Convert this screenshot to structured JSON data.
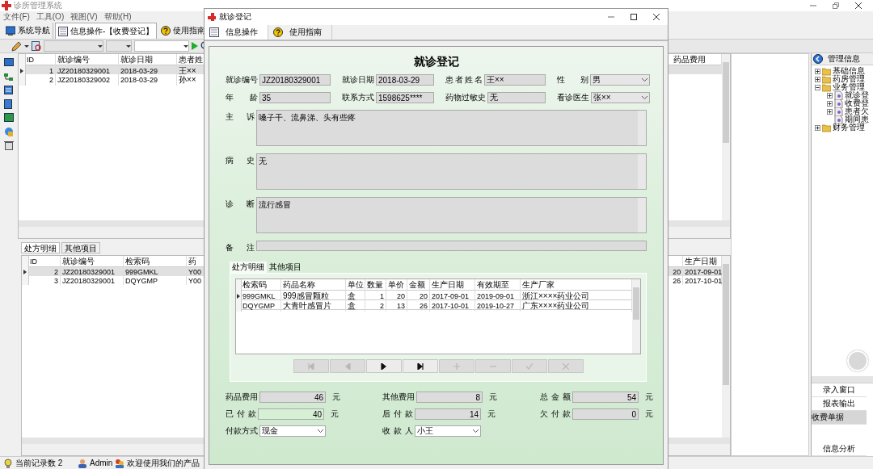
{
  "app": {
    "title": "诊所管理系统",
    "menu": [
      "文件(F)",
      "工具(O)",
      "视图(V)",
      "帮助(H)"
    ],
    "nav_tabs": [
      {
        "label": "系统导航",
        "selected": false,
        "kind": "monitor"
      },
      {
        "label": "信息操作-【收费登记】",
        "selected": true,
        "kind": "form"
      },
      {
        "label": "使用指南",
        "selected": false,
        "kind": "help"
      }
    ]
  },
  "records": {
    "columns": [
      "ID",
      "就诊编号",
      "就诊日期",
      "患者姓"
    ],
    "trailing_column": "药品费用",
    "rows": [
      {
        "cells": [
          "1",
          "JZ20180329001",
          "2018-03-29",
          "王××"
        ],
        "selected": true
      },
      {
        "cells": [
          "2",
          "JZ20180329002",
          "2018-03-29",
          "孙××"
        ],
        "selected": false
      }
    ]
  },
  "detail_tabs": [
    {
      "label": "处方明细",
      "selected": true
    },
    {
      "label": "其他项目",
      "selected": false
    }
  ],
  "details": {
    "columns": [
      "ID",
      "就诊编号",
      "检索码",
      "药"
    ],
    "trailing_columns": [
      "生产日期"
    ],
    "rows": [
      {
        "cells": [
          "2",
          "JZ20180329001",
          "999GMKL",
          "Y00"
        ],
        "trailing_cells": [
          "20",
          "2017-09-01"
        ],
        "selected": true
      },
      {
        "cells": [
          "3",
          "JZ20180329001",
          "DQYGMP",
          "Y00"
        ],
        "trailing_cells": [
          "26",
          "2017-10-01"
        ],
        "selected": false
      }
    ]
  },
  "tree": {
    "title": "管理信息",
    "items": [
      {
        "label": "基础信息",
        "expanded": false
      },
      {
        "label": "药房管理",
        "expanded": false
      },
      {
        "label": "业务管理",
        "expanded": true,
        "children": [
          {
            "label": "就诊登",
            "expanded": false
          },
          {
            "label": "收费登",
            "expanded": false
          },
          {
            "label": "患者欠",
            "expanded": false
          },
          {
            "label": "期间患"
          }
        ]
      },
      {
        "label": "财务管理",
        "expanded": false
      }
    ]
  },
  "shortcuts": [
    {
      "label": "录入窗口",
      "selected": false
    },
    {
      "label": "报表输出",
      "selected": false
    },
    {
      "label": "收费单据",
      "selected": true
    },
    {
      "label": "信息分析",
      "selected": false
    }
  ],
  "status_bar": {
    "record_count": "当前记录数 2",
    "user": "Admin",
    "welcome": "欢迎使用我们的产品"
  },
  "dialog": {
    "title": "就诊登记",
    "tabs": [
      {
        "label": "信息操作",
        "selected": true,
        "kind": "form"
      },
      {
        "label": "使用指南",
        "selected": false,
        "kind": "help"
      }
    ],
    "heading": "就诊登记",
    "fields": [
      {
        "label": "就诊编号",
        "value": "JZ20180329001",
        "kind": "text"
      },
      {
        "label": "就诊日期",
        "value": "2018-03-29",
        "kind": "text"
      },
      {
        "label": "患者姓名",
        "value": "王××",
        "kind": "text"
      },
      {
        "label": "性别",
        "value": "男",
        "kind": "select"
      },
      {
        "label": "年龄",
        "value": "35",
        "kind": "text"
      },
      {
        "label": "联系方式",
        "value": "1598625****",
        "kind": "text"
      },
      {
        "label": "药物过敏史",
        "value": "无",
        "kind": "text"
      },
      {
        "label": "看诊医生",
        "value": "张××",
        "kind": "select"
      }
    ],
    "notes": [
      {
        "label": "主诉",
        "value": "嗓子干、流鼻涕、头有些疼",
        "kind": "area"
      },
      {
        "label": "病史",
        "value": "无",
        "kind": "area"
      },
      {
        "label": "诊断",
        "value": "流行感冒",
        "kind": "area"
      },
      {
        "label": "备注",
        "kind": "line"
      }
    ],
    "rx_tabs": [
      {
        "label": "处方明细",
        "selected": true
      },
      {
        "label": "其他项目",
        "selected": false
      }
    ],
    "rx": {
      "columns": [
        "检索码",
        "药品名称",
        "单位",
        "数量",
        "单价",
        "金额",
        "生产日期",
        "有效期至",
        "生产厂家"
      ],
      "rows": [
        {
          "cells": [
            "999GMKL",
            "999感冒颗粒",
            "盒",
            "1",
            "20",
            "20",
            "2017-09-01",
            "2019-09-01",
            "浙江××××药业公司"
          ],
          "selected": true
        },
        {
          "cells": [
            "DQYGMP",
            "大青叶感冒片",
            "盒",
            "2",
            "13",
            "26",
            "2017-10-01",
            "2019-10-27",
            "广东××××药业公司"
          ],
          "selected": false
        }
      ]
    },
    "navigator": [
      {
        "kind": "first",
        "disabled": true
      },
      {
        "kind": "prior",
        "disabled": true
      },
      {
        "kind": "next",
        "disabled": false
      },
      {
        "kind": "last",
        "disabled": false
      },
      {
        "kind": "insert",
        "disabled": true
      },
      {
        "kind": "delete",
        "disabled": true
      },
      {
        "kind": "post",
        "disabled": true
      },
      {
        "kind": "cancel",
        "disabled": true
      }
    ],
    "fees": [
      {
        "label": "药品费用",
        "value": "46",
        "unit": "元",
        "editable": false
      },
      {
        "label": "其他费用",
        "value": "8",
        "unit": "元",
        "editable": false
      },
      {
        "label": "总金额",
        "value": "54",
        "unit": "元",
        "editable": false
      },
      {
        "label": "已付款",
        "value": "40",
        "unit": "元",
        "editable": true
      },
      {
        "label": "后付款",
        "value": "14",
        "unit": "元",
        "editable": false
      },
      {
        "label": "欠付款",
        "value": "0",
        "unit": "元",
        "editable": false
      }
    ],
    "payment": [
      {
        "label": "付款方式",
        "value": "现金"
      },
      {
        "label": "收款人",
        "value": "小王"
      }
    ]
  }
}
